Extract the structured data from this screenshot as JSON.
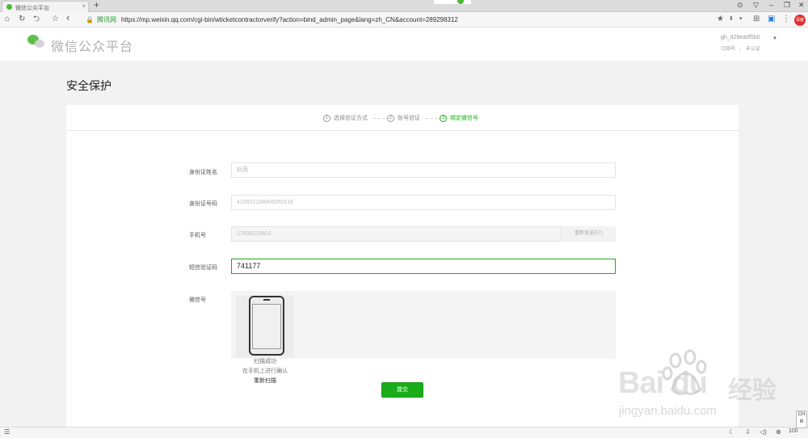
{
  "browser": {
    "tab_title": "微信公众平台",
    "tab_close": "×",
    "new_tab": "+",
    "url_site_tag": "腾讯网",
    "url": "https://mp.weixin.qq.com/cgi-bin/wticketcontractorverify?action=bind_admin_page&lang=zh_CN&account=289298312",
    "window_controls": [
      "⊙",
      "▽",
      "–",
      "❐",
      "✕"
    ],
    "nav_icons": {
      "home": "⌂",
      "reload": "↻",
      "back_history": "⮌",
      "star": "☆",
      "back": "‹"
    },
    "toolbar_icons": {
      "bookmark": "★",
      "extension": "⬇",
      "dropdown": "▾",
      "apps": "⊞",
      "account": "▣",
      "menu": "⋮"
    },
    "red_badge": "百度"
  },
  "site": {
    "logo_text": "微信公众平台",
    "account_name": "gh_d29ea0f5b0",
    "account_type": "订阅号",
    "account_status": "未认证",
    "account_separator": "|"
  },
  "page": {
    "title": "安全保护"
  },
  "steps": [
    {
      "num": "1",
      "label": "选择验证方式"
    },
    {
      "num": "2",
      "label": "账号验证"
    },
    {
      "num": "3",
      "label": "绑定微信号"
    }
  ],
  "form": {
    "id_name_label": "身份证姓名",
    "id_name_value": "赵薇",
    "id_number_label": "身份证号码",
    "id_number_value": "410922198806050516",
    "phone_label": "手机号",
    "phone_value": "17838225601",
    "sms_button": "重新发送(57)",
    "code_label": "短信验证码",
    "code_value": "741177",
    "wechat_label": "微信号",
    "scan_success": "扫描成功",
    "scan_confirm": "在手机上进行确认",
    "rescan": "重新扫描",
    "submit": "提交"
  },
  "watermark": {
    "baidu": "Bai du",
    "jingyan": "经验",
    "url": "jingyan.baidu.com"
  },
  "statusbar": {
    "left_icon": "☰",
    "zoom": "100",
    "ime": "CH"
  }
}
